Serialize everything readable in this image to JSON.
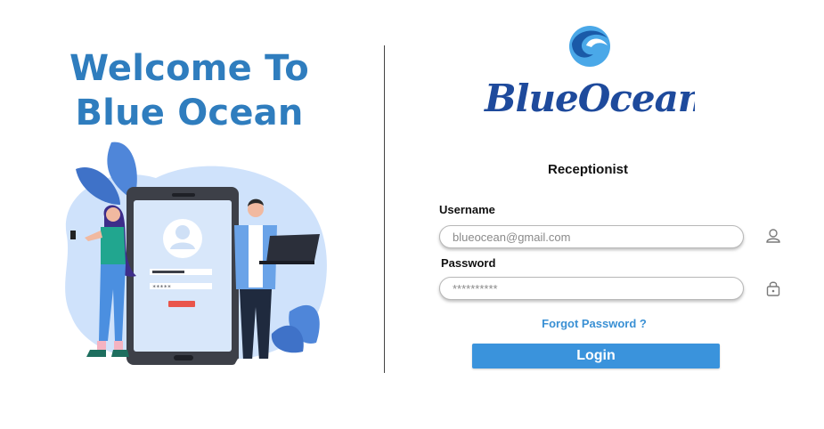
{
  "welcome": {
    "line1": "Welcome To",
    "line2": "Blue Ocean"
  },
  "logo": {
    "text": "BlueOcean"
  },
  "illustration": {
    "password_mask": "*****"
  },
  "form": {
    "role": "Receptionist",
    "username_label": "Username",
    "username_placeholder": "blueocean@gmail.com",
    "password_label": "Password",
    "password_placeholder": "**********",
    "forgot_label": "Forgot Password ?",
    "login_label": "Login"
  },
  "icons": {
    "username": "user-icon",
    "password": "lock-icon"
  },
  "colors": {
    "brand_blue": "#2f7dbe",
    "button_blue": "#3a93dc",
    "link_blue": "#3a90d4",
    "logo_dark": "#1e4a9c"
  }
}
